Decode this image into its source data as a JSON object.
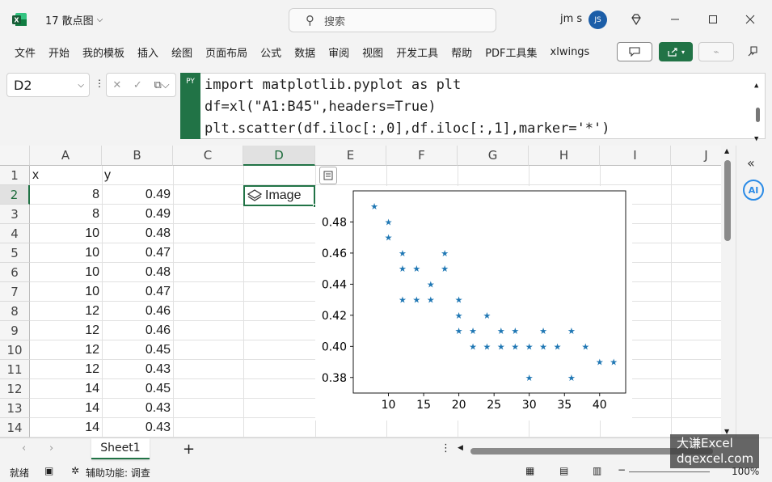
{
  "app": {
    "title": "17 散点图",
    "search_placeholder": "搜索",
    "user_name": "jm s",
    "user_initials": "JS"
  },
  "menu": [
    "文件",
    "开始",
    "我的模板",
    "插入",
    "绘图",
    "页面布局",
    "公式",
    "数据",
    "审阅",
    "视图",
    "开发工具",
    "帮助",
    "PDF工具集",
    "xlwings"
  ],
  "formula_bar": {
    "name_box": "D2",
    "py_badge": "PY",
    "lines": [
      "import matplotlib.pyplot as plt",
      "df=xl(\"A1:B45\",headers=True)",
      "plt.scatter(df.iloc[:,0],df.iloc[:,1],marker='*')"
    ]
  },
  "grid": {
    "columns": [
      "A",
      "B",
      "C",
      "D",
      "E",
      "F",
      "G",
      "H",
      "I",
      "J"
    ],
    "selected_column": "D",
    "rows": [
      "1",
      "2",
      "3",
      "4",
      "5",
      "6",
      "7",
      "8",
      "9",
      "10",
      "11",
      "12",
      "13",
      "14"
    ],
    "selected_row": "2",
    "header_row": [
      "x",
      "y"
    ],
    "data": [
      [
        "8",
        "0.49"
      ],
      [
        "8",
        "0.49"
      ],
      [
        "10",
        "0.48"
      ],
      [
        "10",
        "0.47"
      ],
      [
        "10",
        "0.48"
      ],
      [
        "10",
        "0.47"
      ],
      [
        "12",
        "0.46"
      ],
      [
        "12",
        "0.46"
      ],
      [
        "12",
        "0.45"
      ],
      [
        "12",
        "0.43"
      ],
      [
        "14",
        "0.45"
      ],
      [
        "14",
        "0.43"
      ],
      [
        "14",
        "0.43"
      ]
    ],
    "selected_cell_value": "Image"
  },
  "chart_data": {
    "type": "scatter",
    "marker": "*",
    "color": "#1f77b4",
    "xlim": [
      5,
      43.7
    ],
    "ylim": [
      0.37,
      0.5
    ],
    "x_ticks": [
      "10",
      "15",
      "20",
      "25",
      "30",
      "35",
      "40"
    ],
    "y_ticks": [
      "0.38",
      "0.40",
      "0.42",
      "0.44",
      "0.46",
      "0.48"
    ],
    "points": [
      [
        8,
        0.49
      ],
      [
        10,
        0.48
      ],
      [
        10,
        0.47
      ],
      [
        12,
        0.46
      ],
      [
        12,
        0.45
      ],
      [
        12,
        0.43
      ],
      [
        14,
        0.45
      ],
      [
        14,
        0.43
      ],
      [
        16,
        0.44
      ],
      [
        16,
        0.43
      ],
      [
        18,
        0.46
      ],
      [
        18,
        0.45
      ],
      [
        20,
        0.43
      ],
      [
        20,
        0.42
      ],
      [
        20,
        0.41
      ],
      [
        22,
        0.41
      ],
      [
        22,
        0.4
      ],
      [
        24,
        0.42
      ],
      [
        24,
        0.4
      ],
      [
        26,
        0.41
      ],
      [
        26,
        0.4
      ],
      [
        28,
        0.41
      ],
      [
        28,
        0.4
      ],
      [
        30,
        0.4
      ],
      [
        30,
        0.38
      ],
      [
        32,
        0.41
      ],
      [
        32,
        0.4
      ],
      [
        34,
        0.4
      ],
      [
        36,
        0.41
      ],
      [
        36,
        0.38
      ],
      [
        38,
        0.4
      ],
      [
        40,
        0.39
      ],
      [
        42,
        0.39
      ]
    ]
  },
  "sheet_tabs": [
    "Sheet1"
  ],
  "status": {
    "ready": "就绪",
    "accessibility": "辅助功能: 调查",
    "zoom": "100%"
  },
  "watermark": {
    "line1": "大谦Excel",
    "line2": "dqexcel.com"
  },
  "colors": {
    "excel_green": "#217346",
    "avatar_blue": "#1c5ea8",
    "scatter_blue": "#1f77b4"
  }
}
